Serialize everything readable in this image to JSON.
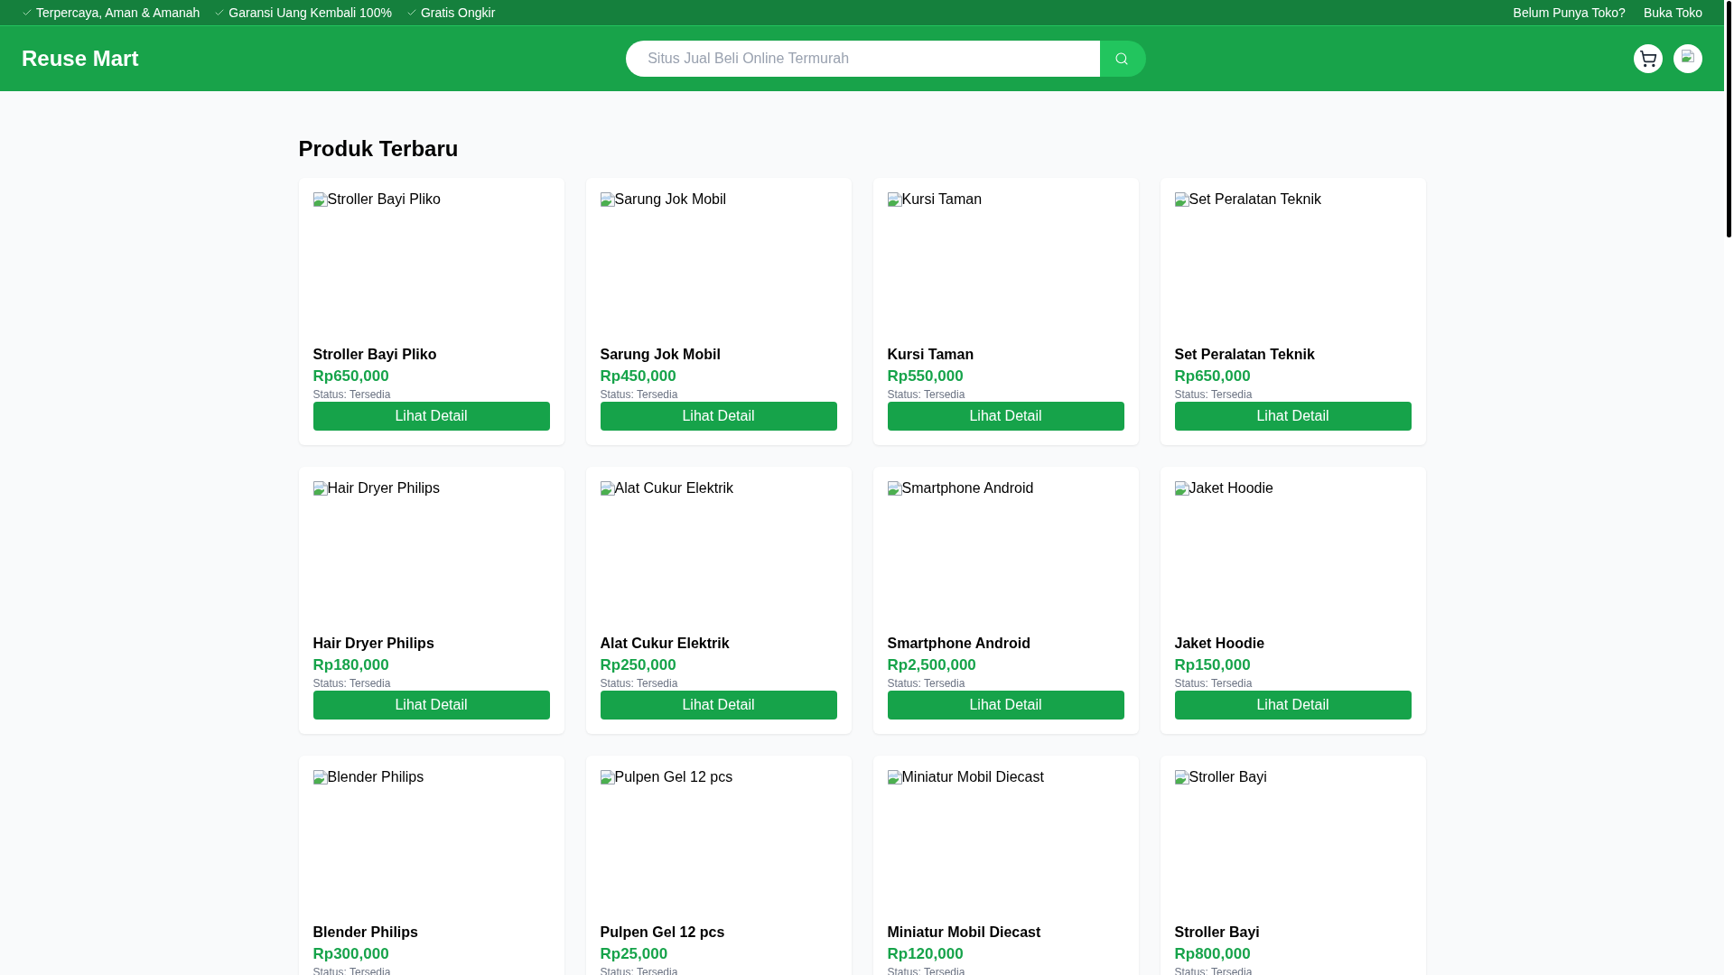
{
  "top_bar": {
    "features": [
      "Terpercaya, Aman & Amanah",
      "Garansi Uang Kembali 100%",
      "Gratis Ongkir"
    ],
    "links": [
      "Belum Punya Toko?",
      "Buka Toko"
    ]
  },
  "header": {
    "logo": "Reuse Mart",
    "search": {
      "placeholder": "Situs Jual Beli Online Termurah"
    }
  },
  "section": {
    "title": "Produk Terbaru",
    "products": [
      {
        "image_alt": "Stroller Bayi Pliko",
        "name": "Stroller Bayi Pliko",
        "price": "Rp650,000",
        "status": "Status: Tersedia",
        "action": "Lihat Detail"
      },
      {
        "image_alt": "Sarung Jok Mobil",
        "name": "Sarung Jok Mobil",
        "price": "Rp450,000",
        "status": "Status: Tersedia",
        "action": "Lihat Detail"
      },
      {
        "image_alt": "Kursi Taman",
        "name": "Kursi Taman",
        "price": "Rp550,000",
        "status": "Status: Tersedia",
        "action": "Lihat Detail"
      },
      {
        "image_alt": "Set Peralatan Teknik",
        "name": "Set Peralatan Teknik",
        "price": "Rp650,000",
        "status": "Status: Tersedia",
        "action": "Lihat Detail"
      },
      {
        "image_alt": "Hair Dryer Philips",
        "name": "Hair Dryer Philips",
        "price": "Rp180,000",
        "status": "Status: Tersedia",
        "action": "Lihat Detail"
      },
      {
        "image_alt": "Alat Cukur Elektrik",
        "name": "Alat Cukur Elektrik",
        "price": "Rp250,000",
        "status": "Status: Tersedia",
        "action": "Lihat Detail"
      },
      {
        "image_alt": "Smartphone Android",
        "name": "Smartphone Android",
        "price": "Rp2,500,000",
        "status": "Status: Tersedia",
        "action": "Lihat Detail"
      },
      {
        "image_alt": "Jaket Hoodie",
        "name": "Jaket Hoodie",
        "price": "Rp150,000",
        "status": "Status: Tersedia",
        "action": "Lihat Detail"
      },
      {
        "image_alt": "Blender Philips",
        "name": "Blender Philips",
        "price": "Rp300,000",
        "status": "Status: Tersedia"
      },
      {
        "image_alt": "Pulpen Gel 12 pcs",
        "name": "Pulpen Gel 12 pcs",
        "price": "Rp25,000",
        "status": "Status: Tersedia"
      },
      {
        "image_alt": "Miniatur Mobil Diecast",
        "name": "Miniatur Mobil Diecast",
        "price": "Rp120,000",
        "status": "Status: Tersedia"
      },
      {
        "image_alt": "Stroller Bayi",
        "name": "Stroller Bayi",
        "price": "Rp800,000",
        "status": "Status: Tersedia"
      }
    ]
  }
}
